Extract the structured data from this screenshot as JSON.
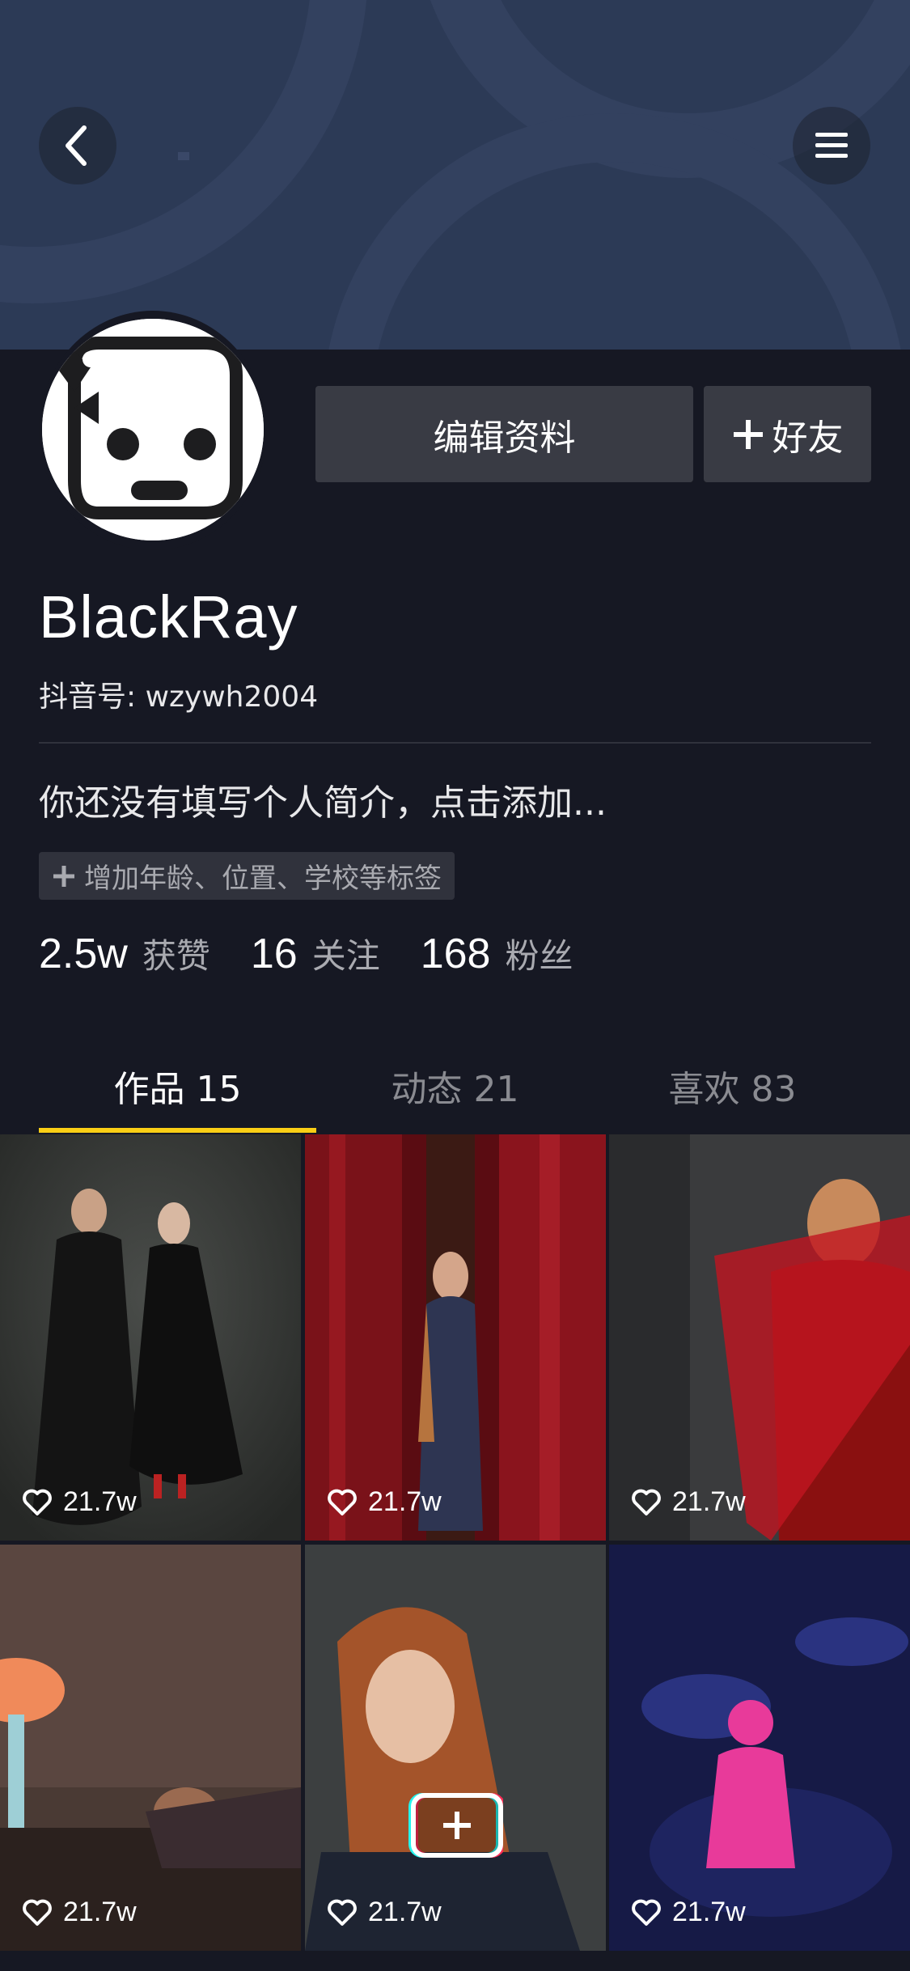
{
  "header": {
    "back_icon": "chevron-left-icon",
    "menu_icon": "hamburger-menu-icon"
  },
  "profile": {
    "edit_button": "编辑资料",
    "add_friend_button": "好友",
    "username": "BlackRay",
    "douyin_id": "抖音号: wzywh2004",
    "bio": "你还没有填写个人简介，点击添加...",
    "tag_button": "增加年龄、位置、学校等标签"
  },
  "stats": [
    {
      "value": "2.5w",
      "label": "获赞"
    },
    {
      "value": "16",
      "label": "关注"
    },
    {
      "value": "168",
      "label": "粉丝"
    }
  ],
  "tabs": [
    {
      "label": "作品 15",
      "active": true
    },
    {
      "label": "动态 21",
      "active": false
    },
    {
      "label": "喜欢 83",
      "active": false
    }
  ],
  "videos": [
    {
      "likes": "21.7w"
    },
    {
      "likes": "21.7w"
    },
    {
      "likes": "21.7w"
    },
    {
      "likes": "21.7w"
    },
    {
      "likes": "21.7w"
    },
    {
      "likes": "21.7w"
    }
  ],
  "colors": {
    "background": "#161823",
    "accent": "#face15",
    "button": "#393b44"
  }
}
